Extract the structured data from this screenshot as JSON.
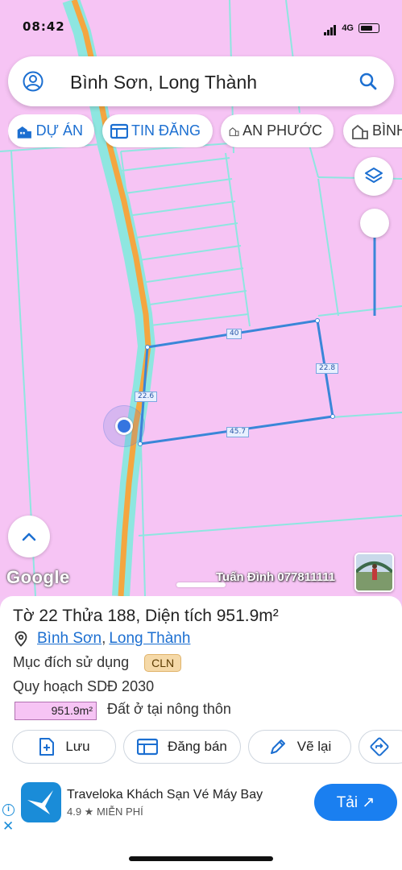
{
  "status_bar": {
    "time": "08:42",
    "network": "4G"
  },
  "search": {
    "query": "Bình Sơn, Long Thành"
  },
  "chips": [
    {
      "label": "DỰ ÁN"
    },
    {
      "label": "TIN ĐĂNG"
    },
    {
      "label": "AN PHƯỚC"
    },
    {
      "label": "BÌNH"
    }
  ],
  "map": {
    "dimensions": {
      "top": "40",
      "right": "22.8",
      "bottom": "45.7",
      "left": "22.6"
    },
    "attribution": "Google",
    "watermark": "Tuấn Đình 077811111"
  },
  "parcel": {
    "title": "Tờ 22 Thửa 188, Diện tích 951.9m²",
    "commune": "Bình Sơn",
    "district": "Long Thành",
    "separator": ",",
    "purpose_label": "Mục đích sử dụng",
    "purpose_code": "CLN",
    "plan_label": "Quy hoạch SDĐ 2030",
    "plan_area": "951.9m²",
    "plan_use": "Đất ở tại nông thôn"
  },
  "actions": {
    "save": "Lưu",
    "post": "Đăng bán",
    "redraw": "Vẽ lại"
  },
  "ad": {
    "title": "Traveloka Khách Sạn Vé Máy Bay",
    "rating": "4.9 ★ MIỄN PHÍ",
    "cta": "Tải ↗",
    "info": "i",
    "close": "✕"
  },
  "colors": {
    "accent": "#1c6fd1",
    "parcel_fill": "#f6c4f4",
    "road": "#f4a640",
    "boundary": "#3a86d8",
    "ad_button": "#1a7ff0"
  }
}
